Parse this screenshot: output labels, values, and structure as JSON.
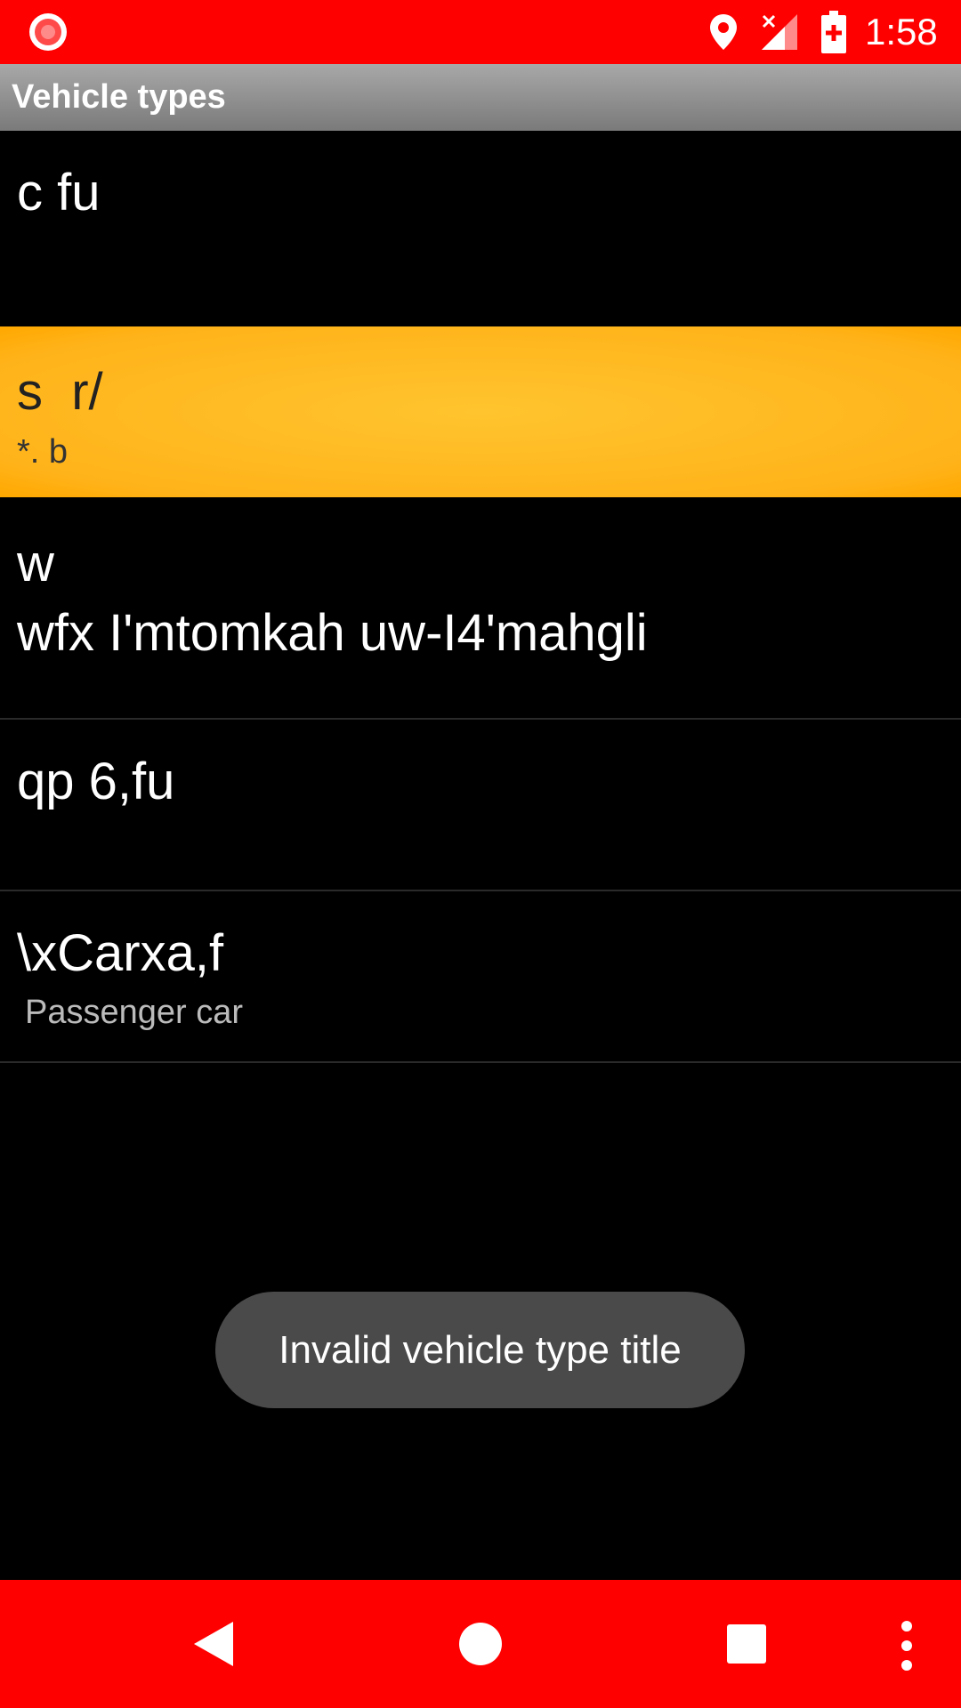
{
  "status_bar": {
    "time": "1:58",
    "icons": [
      "screen-record-icon",
      "location-icon",
      "no-signal-icon",
      "battery-charging-icon"
    ]
  },
  "app_bar": {
    "title": "Vehicle types"
  },
  "list": [
    {
      "title": "c fu",
      "subtitle": ""
    },
    {
      "title": "s  r/",
      "subtitle": "*. b"
    },
    {
      "title": "w\nwfx I'mtomkah uw-I4'mahgli",
      "subtitle": ""
    },
    {
      "title": "qp 6,fu",
      "subtitle": ""
    },
    {
      "title": "\\xCarxa,f",
      "subtitle": "Passenger car"
    }
  ],
  "toast": {
    "message": "Invalid vehicle type title"
  },
  "nav_bar": {
    "icons": [
      "back-icon",
      "home-icon",
      "recents-icon",
      "overflow-menu-icon"
    ]
  },
  "colors": {
    "status_bar": "#ff0000",
    "nav_bar": "#ff0000",
    "selected_item": "#ffb31a",
    "background": "#000000",
    "toast": "#4a4a4a"
  }
}
